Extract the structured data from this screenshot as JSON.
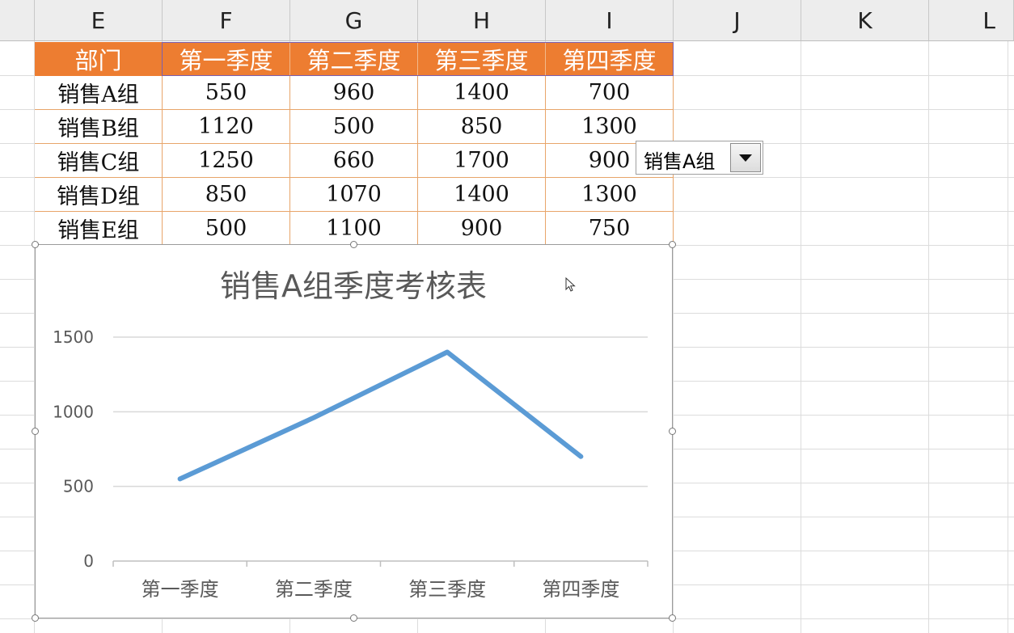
{
  "columns": [
    "E",
    "F",
    "G",
    "H",
    "I",
    "J",
    "K",
    "L"
  ],
  "table": {
    "headers": [
      "部门",
      "第一季度",
      "第二季度",
      "第三季度",
      "第四季度"
    ],
    "rows": [
      [
        "销售A组",
        "550",
        "960",
        "1400",
        "700"
      ],
      [
        "销售B组",
        "1120",
        "500",
        "850",
        "1300"
      ],
      [
        "销售C组",
        "1250",
        "660",
        "1700",
        "900"
      ],
      [
        "销售D组",
        "850",
        "1070",
        "1400",
        "1300"
      ],
      [
        "销售E组",
        "500",
        "1100",
        "900",
        "750"
      ]
    ]
  },
  "dropdown": {
    "selected": "销售A组",
    "icon": "chevron-down-icon"
  },
  "colors": {
    "header_fill": "#ed7d31",
    "line": "#5b9bd5"
  },
  "chart_data": {
    "type": "line",
    "title": "销售A组季度考核表",
    "categories": [
      "第一季度",
      "第二季度",
      "第三季度",
      "第四季度"
    ],
    "series": [
      {
        "values": [
          550,
          960,
          1400,
          700
        ]
      }
    ],
    "y_ticks": [
      "0",
      "500",
      "1000",
      "1500"
    ],
    "ylim": [
      0,
      1500
    ],
    "grid": true,
    "legend": "none"
  }
}
